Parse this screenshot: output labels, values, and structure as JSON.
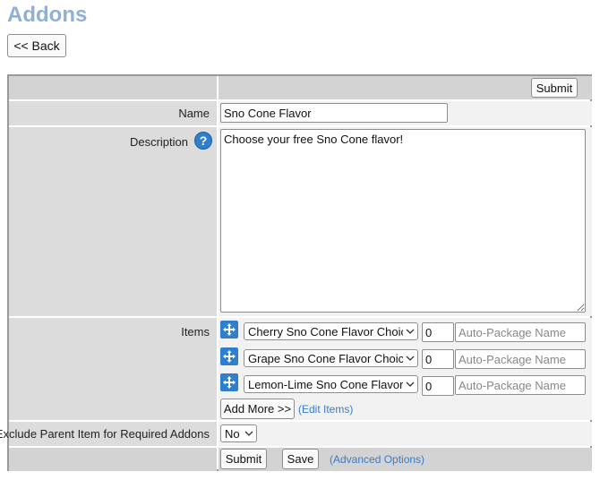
{
  "page": {
    "title": "Addons",
    "back_label": "<< Back"
  },
  "form": {
    "submit_label": "Submit",
    "name": {
      "label": "Name",
      "value": "Sno Cone Flavor"
    },
    "description": {
      "label": "Description",
      "help_glyph": "?",
      "value": "Choose your free Sno Cone flavor!"
    },
    "items": {
      "label": "Items",
      "rows": [
        {
          "selected": "Cherry Sno Cone Flavor Choice (I",
          "qty": "0",
          "package_placeholder": "Auto-Package Name"
        },
        {
          "selected": "Grape Sno Cone Flavor Choice (H",
          "qty": "0",
          "package_placeholder": "Auto-Package Name"
        },
        {
          "selected": "Lemon-Lime Sno Cone Flavor Ch",
          "qty": "0",
          "package_placeholder": "Auto-Package Name"
        }
      ],
      "add_more_label": "Add More >>",
      "edit_items_label": "(Edit Items)"
    },
    "exclude_parent": {
      "label": "Exclude Parent Item for Required Addons",
      "value": "No"
    },
    "footer": {
      "submit_label": "Submit",
      "save_label": "Save",
      "advanced_label": "(Advanced Options)"
    }
  },
  "colors": {
    "title": "#8fb0d9",
    "link": "#3a7cc7",
    "icon_blue": "#2f7fce",
    "label_bg": "#dcdcdc",
    "value_bg": "#f2f2f2"
  },
  "icons": {
    "move": "move-arrows-icon",
    "help": "question-mark-icon",
    "dropdown": "chevron-down-icon"
  }
}
